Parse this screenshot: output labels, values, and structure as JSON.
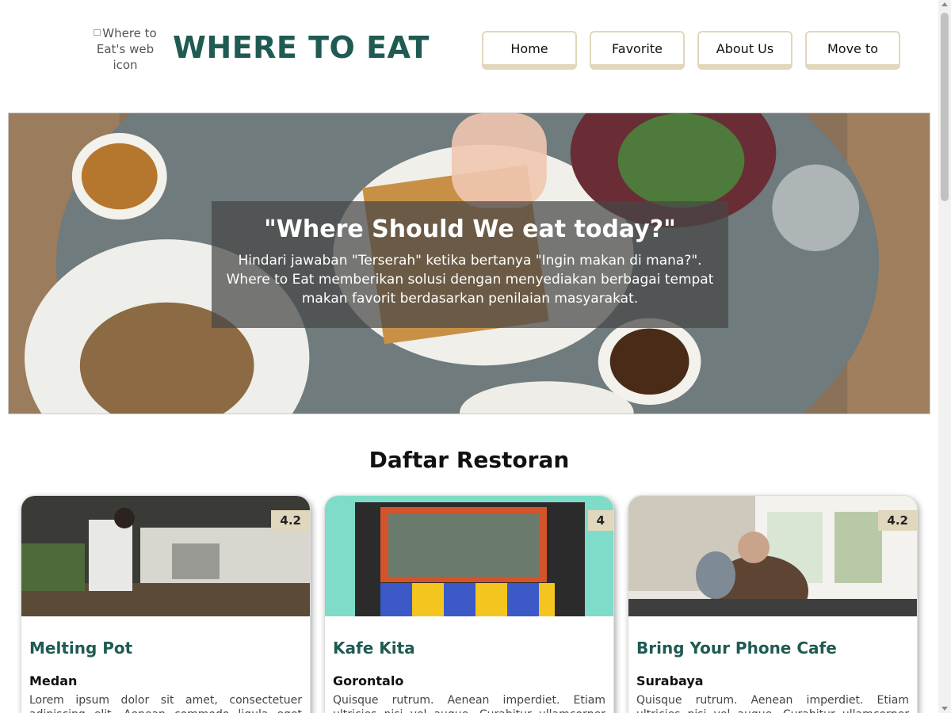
{
  "header": {
    "logo_alt": "Where to Eat's web icon",
    "title": "WHERE TO EAT",
    "nav": [
      {
        "label": "Home"
      },
      {
        "label": "Favorite"
      },
      {
        "label": "About Us"
      },
      {
        "label": "Move to"
      }
    ]
  },
  "hero": {
    "title": "\"Where Should We eat today?\"",
    "text": "Hindari jawaban \"Terserah\" ketika bertanya \"Ingin makan di mana?\". Where to Eat memberikan solusi dengan menyediakan berbagai tempat makan favorit berdasarkan penilaian masyarakat."
  },
  "section": {
    "title": "Daftar Restoran"
  },
  "restaurants": [
    {
      "name": "Melting Pot",
      "city": "Medan",
      "rating": "4.2",
      "description": "Lorem ipsum dolor sit amet, consectetuer adipiscing elit. Aenean commodo ligula eget dolor."
    },
    {
      "name": "Kafe Kita",
      "city": "Gorontalo",
      "rating": "4",
      "description": "Quisque rutrum. Aenean imperdiet. Etiam ultricies nisi vel augue. Curabitur ullamcorper ultricies nisi."
    },
    {
      "name": "Bring Your Phone Cafe",
      "city": "Surabaya",
      "rating": "4.2",
      "description": "Quisque rutrum. Aenean imperdiet. Etiam ultricies nisi vel augue. Curabitur ullamcorper ultricies nisi."
    }
  ],
  "colors": {
    "brand": "#1f5b52",
    "accent": "#e0d7bc"
  }
}
